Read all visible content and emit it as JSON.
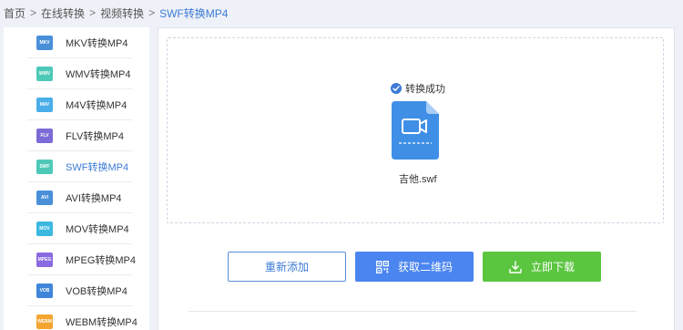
{
  "breadcrumb": {
    "items": [
      "首页",
      "在线转换",
      "视频转换",
      "SWF转换MP4"
    ],
    "separator": ">"
  },
  "sidebar": {
    "items": [
      {
        "label": "MKV转换MP4",
        "icon": "MKV",
        "color": "#4a90d9"
      },
      {
        "label": "WMV转换MP4",
        "icon": "WMV",
        "color": "#4ec9b8"
      },
      {
        "label": "M4V转换MP4",
        "icon": "M4V",
        "color": "#4aaee8"
      },
      {
        "label": "FLV转换MP4",
        "icon": "FLV",
        "color": "#7b6bd6"
      },
      {
        "label": "SWF转换MP4",
        "icon": "SWF",
        "color": "#4ec9b8",
        "active": true
      },
      {
        "label": "AVI转换MP4",
        "icon": "AVI",
        "color": "#4a90d9"
      },
      {
        "label": "MOV转换MP4",
        "icon": "MOV",
        "color": "#3cb8e0"
      },
      {
        "label": "MPEG转换MP4",
        "icon": "MPEG",
        "color": "#8a6ae0"
      },
      {
        "label": "VOB转换MP4",
        "icon": "VOB",
        "color": "#3f86d8"
      },
      {
        "label": "WEBM转换MP4",
        "icon": "WEBM",
        "color": "#f2a530"
      }
    ]
  },
  "main": {
    "status": "转换成功",
    "file_name": "吉他.swf",
    "buttons": {
      "readd": "重新添加",
      "qr": "获取二维码",
      "download": "立即下载"
    }
  },
  "colors": {
    "accent": "#3c7bd6",
    "qr_button": "#4a85f0",
    "download_button": "#5bc540",
    "file_icon": "#3f8fe6"
  }
}
